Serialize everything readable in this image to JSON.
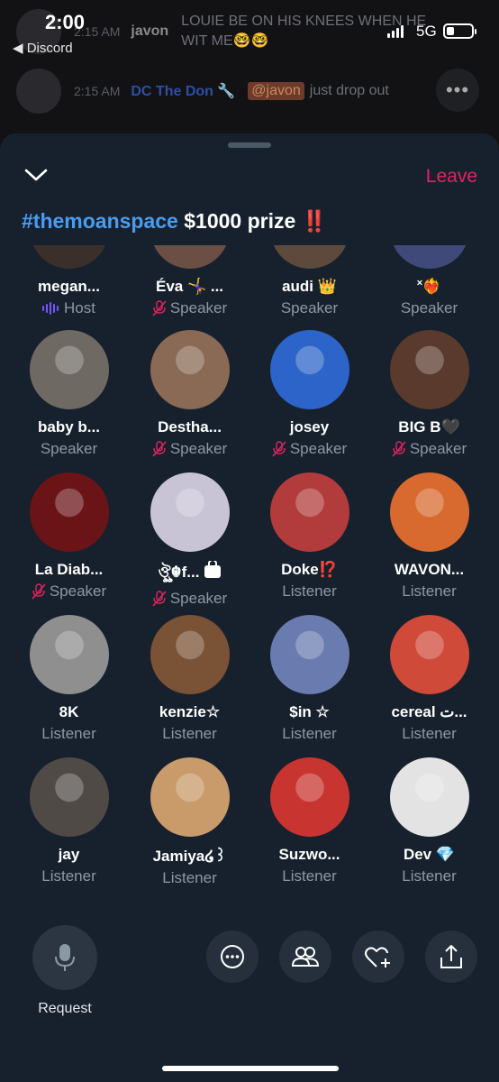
{
  "status_bar": {
    "time": "2:00",
    "back_app": "◀ Discord",
    "network": "5G"
  },
  "background_chat": [
    {
      "time": "2:15 AM",
      "user": "javon",
      "message": "LOUIE BE ON HIS KNEES WHEN HE WIT ME🤓🤓"
    },
    {
      "time": "2:15 AM",
      "user": "DC The Don 🔧",
      "mention": "@javon",
      "message": "just drop out"
    }
  ],
  "space": {
    "leave_label": "Leave",
    "title_hashtag": "#themoanspace",
    "title_rest": " $1000 prize ‼️"
  },
  "participants": [
    {
      "name": "megan...",
      "role": "Host",
      "muted": false,
      "host": true,
      "color": "#3a2f2b"
    },
    {
      "name": "Éva 🤸‍♀️ ...",
      "role": "Speaker",
      "muted": true,
      "host": false,
      "color": "#6b4f45"
    },
    {
      "name": "audi 👑",
      "role": "Speaker",
      "muted": false,
      "host": false,
      "color": "#5d4a3c"
    },
    {
      "name": "˟❤️‍🔥",
      "role": "Speaker",
      "muted": false,
      "host": false,
      "color": "#3f4a7a"
    },
    {
      "name": "baby b...",
      "role": "Speaker",
      "muted": false,
      "host": false,
      "color": "#6e6a63"
    },
    {
      "name": "Destha...",
      "role": "Speaker",
      "muted": true,
      "host": false,
      "color": "#8a6a55"
    },
    {
      "name": "josey",
      "role": "Speaker",
      "muted": true,
      "host": false,
      "color": "#2c64c9"
    },
    {
      "name": "BIG B🖤",
      "role": "Speaker",
      "muted": true,
      "host": false,
      "color": "#5a3a2c"
    },
    {
      "name": "La Diab...",
      "role": "Speaker",
      "muted": true,
      "host": false,
      "color": "#6b1418"
    },
    {
      "name": "ঔৣ☬f...",
      "role": "Speaker",
      "muted": true,
      "host": false,
      "locked": true,
      "color": "#c9c3d6"
    },
    {
      "name": "Doke⁉️",
      "role": "Listener",
      "muted": false,
      "host": false,
      "color": "#b23b3b"
    },
    {
      "name": "WAVON...",
      "role": "Listener",
      "muted": false,
      "host": false,
      "color": "#d96a2f"
    },
    {
      "name": "8K",
      "role": "Listener",
      "muted": false,
      "host": false,
      "color": "#8f8f8f"
    },
    {
      "name": "kenzie☆",
      "role": "Listener",
      "muted": false,
      "host": false,
      "color": "#7a5236"
    },
    {
      "name": "$in ☆",
      "role": "Listener",
      "muted": false,
      "host": false,
      "color": "#6a7bb0"
    },
    {
      "name": "cereal ت...",
      "role": "Listener",
      "muted": false,
      "host": false,
      "color": "#d04a3a"
    },
    {
      "name": "jay",
      "role": "Listener",
      "muted": false,
      "host": false,
      "color": "#4f4a45"
    },
    {
      "name": "Jamiya໒꒱",
      "role": "Listener",
      "muted": false,
      "host": false,
      "color": "#c99a6a"
    },
    {
      "name": "Suzwo...",
      "role": "Listener",
      "muted": false,
      "host": false,
      "color": "#c8342f"
    },
    {
      "name": "Dev 💎",
      "role": "Listener",
      "muted": false,
      "host": false,
      "color": "#e3e3e3"
    }
  ],
  "bottom_bar": {
    "request_label": "Request",
    "actions": [
      "more-icon",
      "people-icon",
      "heart-add-icon",
      "share-icon"
    ]
  },
  "colors": {
    "sheet_bg": "#17212d",
    "accent_blue": "#4a9cf0",
    "leave_red": "#e0245e",
    "host_purple": "#7856ff",
    "muted_gray": "#8b98a5"
  }
}
